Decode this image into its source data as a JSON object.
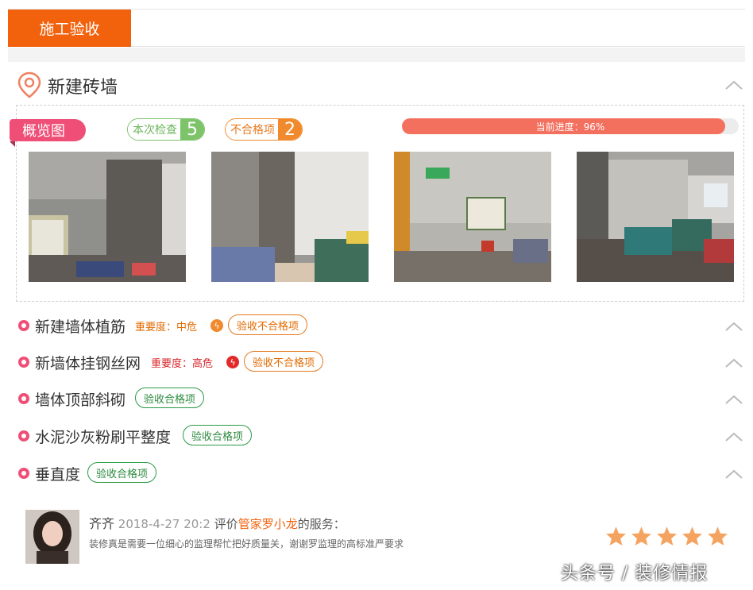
{
  "tabs": {
    "active_label": "施工验收"
  },
  "section": {
    "title": "新建砖墙"
  },
  "overview": {
    "ribbon_label": "概览图",
    "check_label": "本次检查",
    "check_count": "5",
    "fail_label": "不合格项",
    "fail_count": "2",
    "progress_text": "当前进度：96%",
    "progress_value": 0.96
  },
  "photos": [
    {
      "icon": "construction-photo"
    },
    {
      "icon": "construction-photo"
    },
    {
      "icon": "construction-photo"
    },
    {
      "icon": "construction-photo"
    }
  ],
  "items": [
    {
      "title": "新建墙体植筋",
      "severity": "重要度：中危",
      "severity_level": "mid",
      "status": "验收不合格项",
      "pass": false
    },
    {
      "title": "新墙体挂钢丝网",
      "severity": "重要度：高危",
      "severity_level": "high",
      "status": "验收不合格项",
      "pass": false
    },
    {
      "title": "墙体顶部斜砌",
      "status": "验收合格项",
      "pass": true
    },
    {
      "title": "水泥沙灰粉刷平整度",
      "status": "验收合格项",
      "pass": true
    },
    {
      "title": "垂直度",
      "status": "验收合格项",
      "pass": true
    }
  ],
  "review": {
    "name": "齐齐",
    "date": "2018-4-27 20:2",
    "prefix": "评价",
    "steward": "管家罗小龙",
    "suffix": "的服务：",
    "text": "装修真是需要一位细心的监理帮忙把好质量关，谢谢罗监理的高标准严要求",
    "rating": 5
  },
  "watermark": "头条号 / 装修情报",
  "colors": {
    "accent": "#f2610c",
    "pink": "#ef4f77",
    "pass": "#2b8a3e",
    "warn": "#e26a00",
    "danger": "#d8262b",
    "star": "#f4a460"
  }
}
